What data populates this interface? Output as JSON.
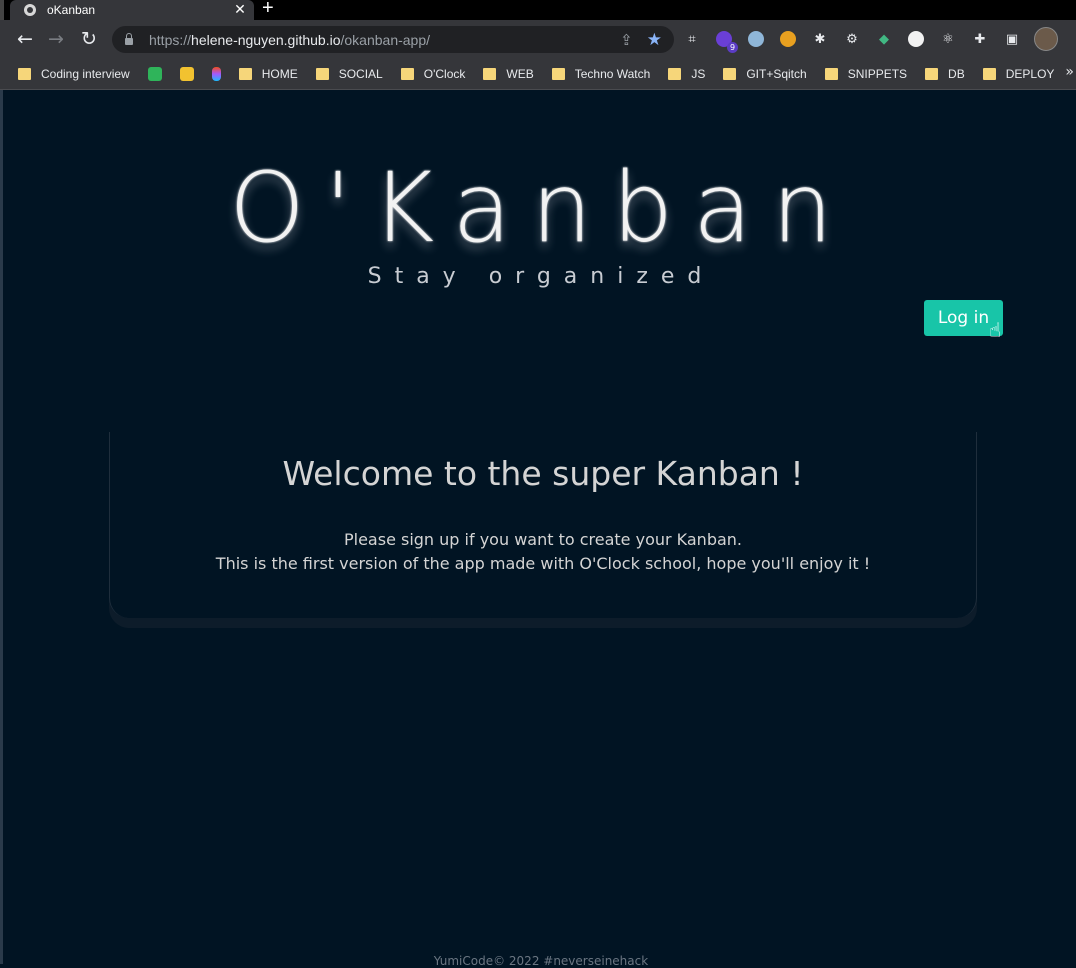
{
  "browser": {
    "tab_title": "oKanban",
    "url_prefix": "https://",
    "url_host": "helene-nguyen.github.io",
    "url_path": "/okanban-app/",
    "ext_badge": "9",
    "bookmarks": [
      "Coding interview",
      "HOME",
      "SOCIAL",
      "O'Clock",
      "WEB",
      "Techno Watch",
      "JS",
      "GIT+Sqitch",
      "SNIPPETS",
      "DB",
      "DEPLOY"
    ]
  },
  "page": {
    "logo": "O'Kanban",
    "tagline": "Stay organized",
    "login_label": "Log in",
    "card_title": "Welcome to the super Kanban !",
    "card_line1": "Please sign up if you want to create your Kanban.",
    "card_line2": "This is the first version of the app made with O'Clock school, hope you'll enjoy it !",
    "footer": "YumiCode© 2022 #neverseinehack"
  },
  "colors": {
    "page_bg": "#011423",
    "accent": "#18c5a8",
    "chrome_bg": "#35363a"
  }
}
